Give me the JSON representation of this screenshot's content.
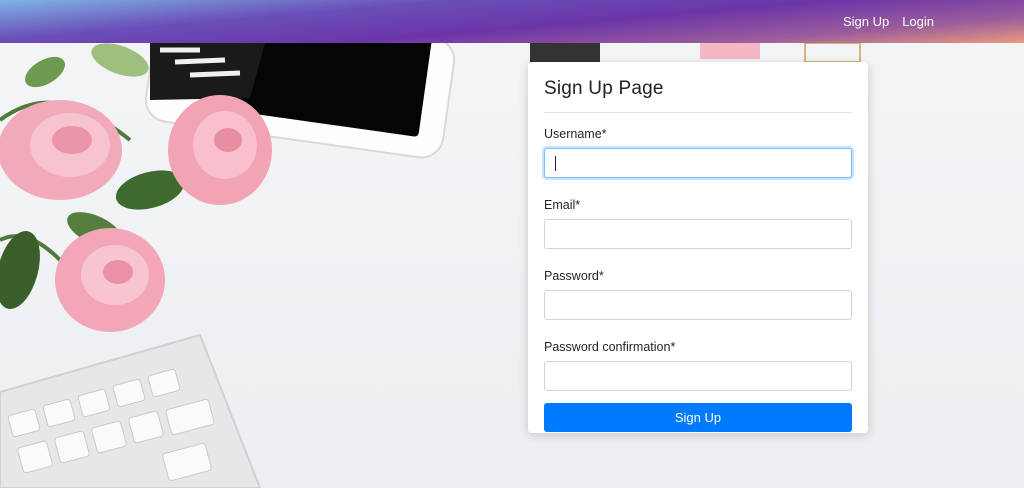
{
  "navbar": {
    "links": [
      "Sign Up",
      "Login"
    ]
  },
  "form": {
    "title": "Sign Up Page",
    "fields": [
      {
        "label": "Username*",
        "value": "",
        "focused": true
      },
      {
        "label": "Email*",
        "value": ""
      },
      {
        "label": "Password*",
        "value": ""
      },
      {
        "label": "Password confirmation*",
        "value": ""
      }
    ],
    "submit_label": "Sign Up"
  },
  "colors": {
    "primary": "#007bff",
    "focus_border": "#80bdff"
  }
}
